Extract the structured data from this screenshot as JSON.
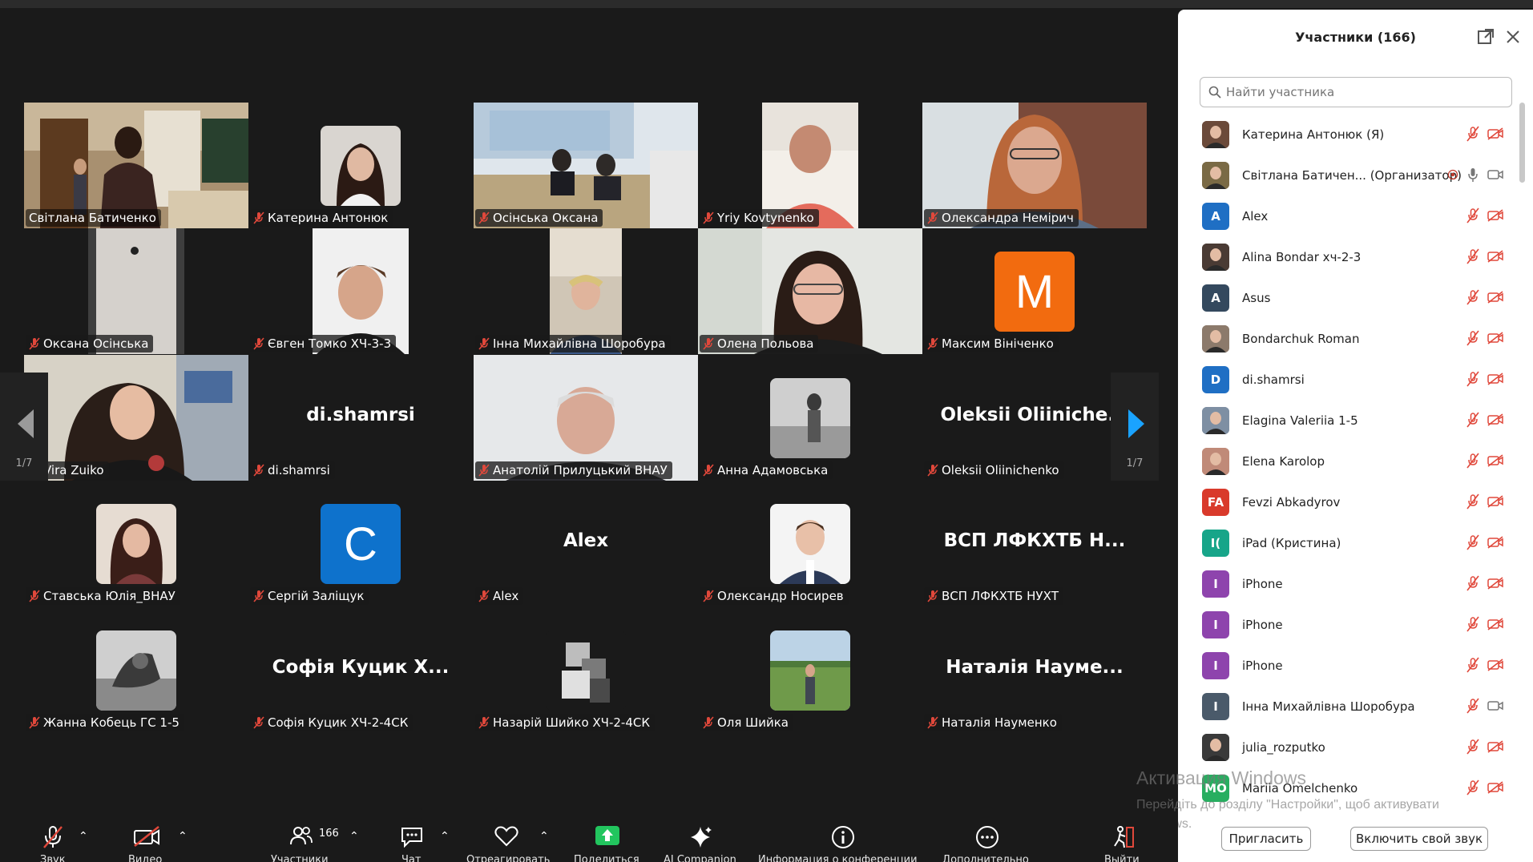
{
  "gallery": {
    "page_indicator": "1/7",
    "tiles": [
      {
        "name": "Світлана Батиченко",
        "mic_muted": false
      },
      {
        "name": "Катерина Антонюк",
        "mic_muted": true
      },
      {
        "name": "Осінська Оксана",
        "mic_muted": true
      },
      {
        "name": "Yriy Kovtynenko",
        "mic_muted": true
      },
      {
        "name": "Олександра Немірич",
        "mic_muted": true
      },
      {
        "name": "Оксана Осінська",
        "mic_muted": true
      },
      {
        "name": "Євген Томко ХЧ-3-3",
        "mic_muted": true
      },
      {
        "name": "Інна Михайлівна Шоробура",
        "mic_muted": true
      },
      {
        "name": "Олена Польова",
        "mic_muted": true
      },
      {
        "name": "Максим Вініченко",
        "avatar_letter": "M",
        "avatar_color": "#f26b0f",
        "mic_muted": true
      },
      {
        "name": "Vira Zuiko",
        "mic_muted": true
      },
      {
        "name": "di.shamrsi",
        "display_name": "di.shamrsi",
        "mic_muted": true
      },
      {
        "name": "Анатолій Прилуцький ВНАУ",
        "mic_muted": true
      },
      {
        "name": "Анна Адамовська",
        "mic_muted": true
      },
      {
        "name": "Oleksii Oliinichenko",
        "display_name": "Oleksii  Oliiniche...",
        "mic_muted": true
      },
      {
        "name": "Ставська Юлія_ВНАУ",
        "mic_muted": true
      },
      {
        "name": "Сергій Заліщук",
        "avatar_letter": "C",
        "avatar_color": "#0e72cc",
        "mic_muted": true
      },
      {
        "name": "Alex",
        "display_name": "Alex",
        "mic_muted": true
      },
      {
        "name": "Олександр Носирев",
        "mic_muted": true
      },
      {
        "name": "ВСП ЛФКХТБ НУХТ",
        "display_name": "ВСП  ЛФКХТБ  Н...",
        "mic_muted": true
      },
      {
        "name": "Жанна Кобець ГС 1-5",
        "mic_muted": true
      },
      {
        "name": "Софія Куцик ХЧ-2-4СК",
        "display_name": "Софія  Куцик  Х...",
        "mic_muted": true
      },
      {
        "name": "Назарій Шийко ХЧ-2-4СК",
        "mic_muted": true
      },
      {
        "name": "Оля Шийка",
        "mic_muted": true
      },
      {
        "name": "Наталія Науменко",
        "display_name": "Наталія  Науме...",
        "mic_muted": true
      }
    ]
  },
  "panel": {
    "title": "Участники (166)",
    "search_placeholder": "Найти участника",
    "participants": [
      {
        "name": "Катерина Антонюк (Я)",
        "initials": "",
        "color": "#6b4a3a",
        "video_on": false,
        "mic_muted": true
      },
      {
        "name": "Світлана Батичен... (Организатор)",
        "initials": "",
        "color": "#7a6a45",
        "video_on": true,
        "mic_muted": false,
        "host": true
      },
      {
        "name": "Alex",
        "initials": "A",
        "color": "#1f6fc4",
        "video_on": false,
        "mic_muted": true
      },
      {
        "name": "Alina Bondar хч-2-3",
        "initials": "",
        "color": "#4a3b34",
        "video_on": false,
        "mic_muted": true
      },
      {
        "name": "Asus",
        "initials": "A",
        "color": "#34495e",
        "video_on": false,
        "mic_muted": true
      },
      {
        "name": "Bondarchuk Roman",
        "initials": "",
        "color": "#8c7a6b",
        "video_on": false,
        "mic_muted": true
      },
      {
        "name": "di.shamrsi",
        "initials": "D",
        "color": "#1f6fc4",
        "video_on": false,
        "mic_muted": true
      },
      {
        "name": "Elagina Valeriia 1-5",
        "initials": "",
        "color": "#7e8fa3",
        "video_on": false,
        "mic_muted": true
      },
      {
        "name": "Elena Karolop",
        "initials": "",
        "color": "#c08a78",
        "video_on": false,
        "mic_muted": true
      },
      {
        "name": "Fevzi Abkadyrov",
        "initials": "FA",
        "color": "#d93a2b",
        "video_on": false,
        "mic_muted": true
      },
      {
        "name": "iPad (Кристина)",
        "initials": "I(",
        "color": "#17a589",
        "video_on": false,
        "mic_muted": true
      },
      {
        "name": "iPhone",
        "initials": "I",
        "color": "#8e44ad",
        "video_on": false,
        "mic_muted": true
      },
      {
        "name": "iPhone",
        "initials": "I",
        "color": "#8e44ad",
        "video_on": false,
        "mic_muted": true
      },
      {
        "name": "iPhone",
        "initials": "I",
        "color": "#8e44ad",
        "video_on": false,
        "mic_muted": true
      },
      {
        "name": "Інна Михайлівна Шоробура",
        "initials": "I",
        "color": "#4a5a6a",
        "video_on": true,
        "mic_muted": true
      },
      {
        "name": "julia_rozputko",
        "initials": "",
        "color": "#3a3a3a",
        "video_on": false,
        "mic_muted": true
      },
      {
        "name": "Mariia Omelchenko",
        "initials": "MO",
        "color": "#27ae60",
        "video_on": false,
        "mic_muted": true
      }
    ],
    "invite_label": "Пригласить",
    "unmute_label": "Включить свой звук"
  },
  "watermark": {
    "line1": "Активация Windows",
    "line2": "Перейдіть до розділу \"Настройки\", щоб активувати Windows."
  },
  "toolbar": {
    "audio": "Звук",
    "video": "Видео",
    "participants": "Участники",
    "participants_count": "166",
    "chat": "Чат",
    "react": "Отреагировать",
    "share": "Поделиться",
    "ai": "AI Companion",
    "info": "Информация о конференции",
    "more": "Дополнительно",
    "leave": "Выйти"
  },
  "colors": {
    "accent_green": "#23d96e",
    "muted_red": "#e0483b",
    "share_green": "#22c55e",
    "arrow_blue": "#1aa3ff"
  }
}
